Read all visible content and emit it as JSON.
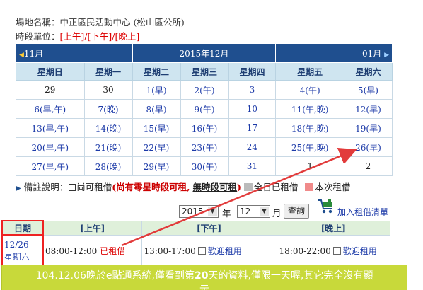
{
  "venue": {
    "label": "場地名稱：",
    "name": "中正區民活動中心 (松山區公所)"
  },
  "period_unit": {
    "label": "時段單位：",
    "value": "[上午]/[下午]/[晚上]"
  },
  "calendar": {
    "prev_month": "11月",
    "current": "2015年12月",
    "next_month": "01月",
    "weekdays": [
      "星期日",
      "星期一",
      "星期二",
      "星期三",
      "星期四",
      "星期五",
      "星期六"
    ],
    "weeks": [
      [
        "29",
        "30",
        "1(早)",
        "2(午)",
        "3",
        "4(午)",
        "5(早)"
      ],
      [
        "6(早,午)",
        "7(晚)",
        "8(早)",
        "9(午)",
        "10",
        "11(午,晚)",
        "12(早)"
      ],
      [
        "13(早,午)",
        "14(晚)",
        "15(早)",
        "16(午)",
        "17",
        "18(午,晚)",
        "19(早)"
      ],
      [
        "20(早,午)",
        "21(晚)",
        "22(早)",
        "23(午)",
        "24",
        "25(午,晚)",
        "26(早)"
      ],
      [
        "27(早,午)",
        "28(晚)",
        "29(早)",
        "30(午)",
        "31",
        "1",
        "2"
      ]
    ]
  },
  "legend": {
    "label": "備註說明：",
    "available": "尚可租借",
    "zero_slots": "(尚有零星時段可租,",
    "no_slots": "無時段可租",
    "close": ")",
    "fully_booked": "全日已租借",
    "this_booking": "本次租借"
  },
  "controls": {
    "year": "2015",
    "year_label": "年",
    "month": "12",
    "month_label": "月",
    "query_button": "查詢",
    "add_cart_link": "加入租借清單"
  },
  "booking": {
    "headers": [
      "日期",
      "[上午]",
      "[下午]",
      "[晚上]"
    ],
    "date": "12/26",
    "weekday": "星期六",
    "morning_time": "08:00-12:00",
    "morning_status": "已租借",
    "afternoon_time": "13:00-17:00",
    "afternoon_status": "歡迎租用",
    "evening_time": "18:00-22:00",
    "evening_status": "歡迎租用"
  },
  "banner": {
    "text_a": "104.12.06晚於e點通系統,僅看到第",
    "text_b": "20",
    "text_c": "天的資料,僅限一天喔,其它完全沒有顯",
    "text_d": "示"
  },
  "colors": {
    "nav_bg": "#1f4f8f",
    "header_bg": "#cfe5f0",
    "link": "#1c3aa8",
    "alert": "#d00000",
    "banner_bg": "#c8d93a"
  }
}
